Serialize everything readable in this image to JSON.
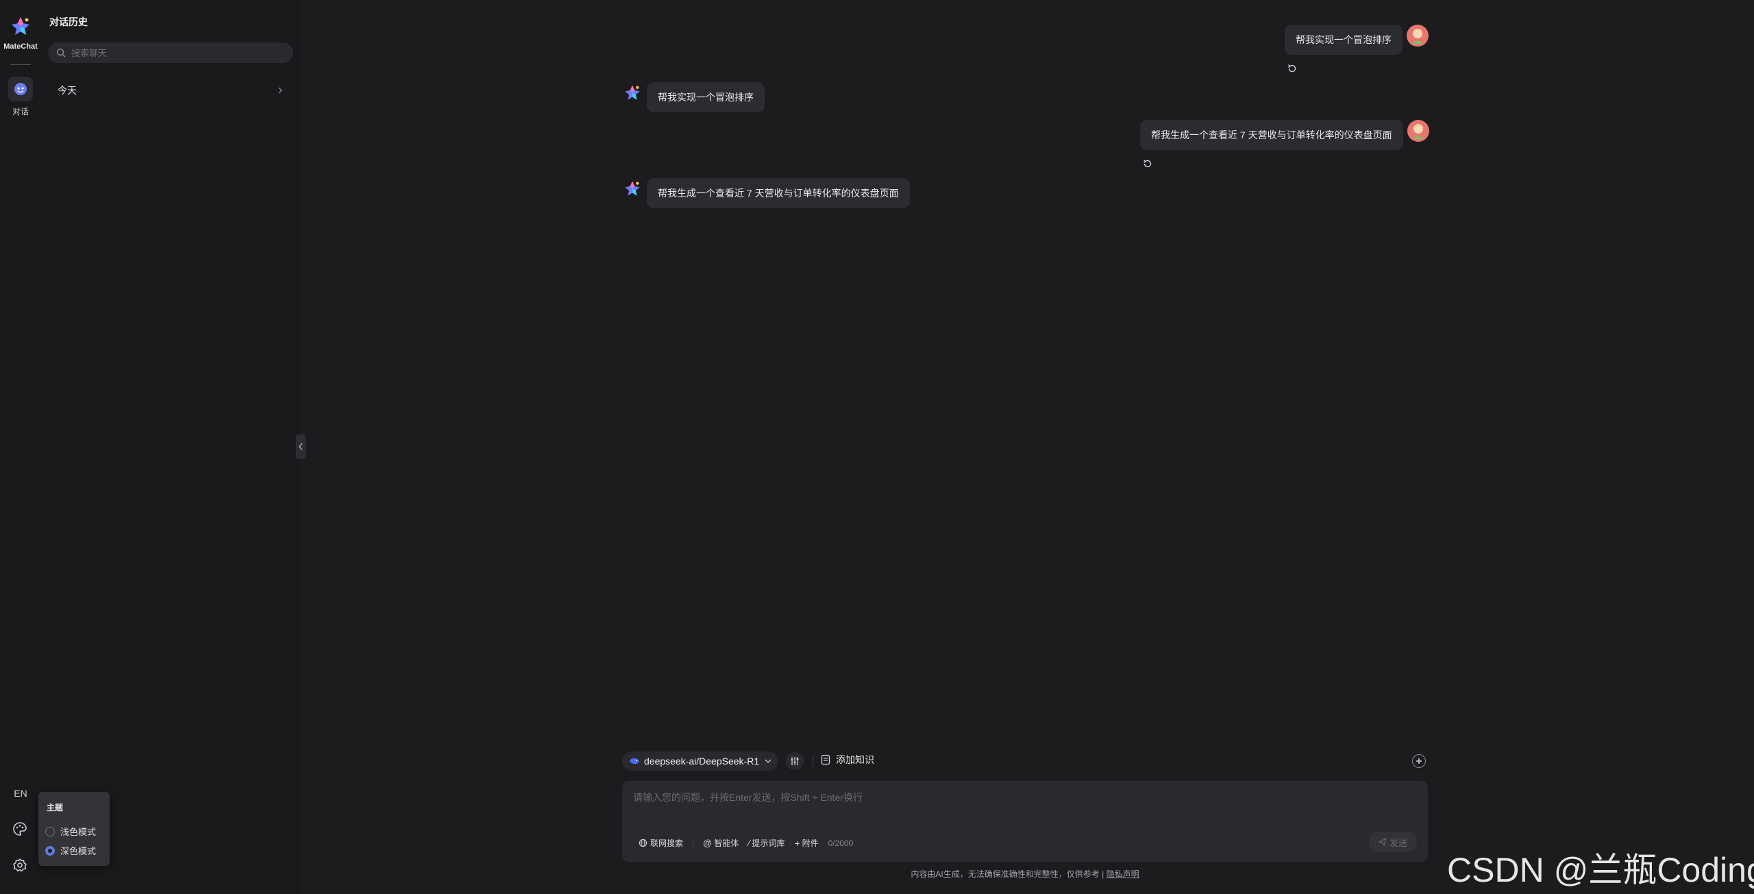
{
  "app": {
    "name": "MateChat"
  },
  "rail": {
    "nav_chat_label": "对话",
    "language": "EN"
  },
  "history": {
    "title": "对话历史",
    "search_placeholder": "搜索聊天",
    "groups": [
      {
        "label": "今天"
      }
    ]
  },
  "conversation": [
    {
      "role": "user",
      "text": "帮我实现一个冒泡排序"
    },
    {
      "role": "assistant",
      "text": "帮我实现一个冒泡排序"
    },
    {
      "role": "user",
      "text": "帮我生成一个查看近 7 天营收与订单转化率的仪表盘页面"
    },
    {
      "role": "assistant",
      "text": "帮我生成一个查看近 7 天营收与订单转化率的仪表盘页面"
    }
  ],
  "composer": {
    "model": "deepseek-ai/DeepSeek-R1",
    "add_knowledge": "添加知识",
    "placeholder": "请输入您的问题，并按Enter发送，按Shift + Enter换行",
    "tools": {
      "web_search": "联网搜索",
      "agent": "智能体",
      "prompts": "提示词库",
      "attachment": "附件"
    },
    "char_count": "0/2000",
    "send": "发送"
  },
  "disclaimer": {
    "text": "内容由AI生成，无法确保准确性和完整性，仅供参考 | ",
    "link": "隐私声明"
  },
  "theme_popover": {
    "title": "主题",
    "options": [
      {
        "label": "浅色模式",
        "selected": false
      },
      {
        "label": "深色模式",
        "selected": true
      }
    ]
  },
  "watermark": "CSDN @兰瓶Coding",
  "colors": {
    "background": "#1c1c1e",
    "panel": "#1a1a1c",
    "bubble": "#2c2c30",
    "accent": "#5e7ce0",
    "avatar": "#e7766d"
  }
}
